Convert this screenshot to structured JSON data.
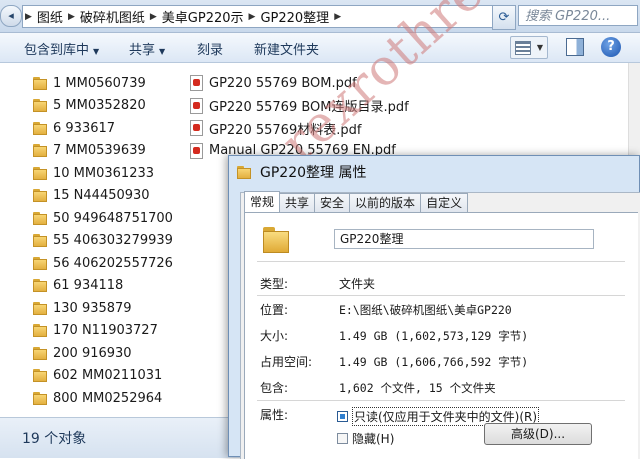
{
  "address_bar": {
    "crumbs": [
      "图纸",
      "破碎机图纸",
      "美卓GP220示",
      "GP220整理"
    ],
    "search_placeholder": "搜索 GP220..."
  },
  "toolbar": {
    "include_in_library": "包含到库中",
    "share": "共享",
    "burn": "刻录",
    "new_folder": "新建文件夹",
    "help": "?"
  },
  "folders": [
    "1 MM0560739",
    "5 MM0352820",
    "6 933617",
    "7 MM0539639",
    "10 MM0361233",
    "15 N44450930",
    "50 949648751700",
    "55 406303279939",
    "56 406202557726",
    "61 934118",
    "130 935879",
    "170 N11903727",
    "200 916930",
    "602 MM0211031",
    "800 MM0252964"
  ],
  "files": [
    "GP220 55769 BOM.pdf",
    "GP220 55769 BOM连版目录.pdf",
    "GP220 55769材料表.pdf",
    "Manual GP220 55769 EN.pdf"
  ],
  "status": {
    "count": "19 个对象"
  },
  "dialog": {
    "title": "GP220整理 属性",
    "tabs": [
      "常规",
      "共享",
      "安全",
      "以前的版本",
      "自定义"
    ],
    "folder_name": "GP220整理",
    "type_label": "类型:",
    "type_value": "文件夹",
    "location_label": "位置:",
    "location_value": "E:\\图纸\\破碎机图纸\\美卓GP220",
    "size_label": "大小:",
    "size_value": "1.49 GB (1,602,573,129 字节)",
    "disk_label": "占用空间:",
    "disk_value": "1.49 GB (1,606,766,592 字节)",
    "contains_label": "包含:",
    "contains_value": "1,602 个文件, 15 个文件夹",
    "attributes_label": "属性:",
    "readonly_label": "只读(仅应用于文件夹中的文件)(R)",
    "hidden_label": "隐藏(H)",
    "advanced_label": "高级(D)..."
  },
  "watermark": "rexrothreducer",
  "colors": {
    "watermark": "#cd7878",
    "accent": "#2f7fd0"
  }
}
